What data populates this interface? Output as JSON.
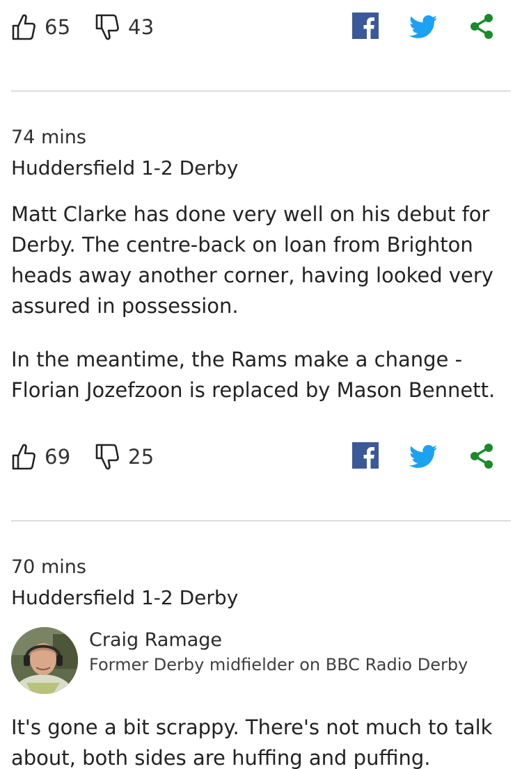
{
  "posts": [
    {
      "reactions": {
        "likes": "65",
        "dislikes": "43"
      }
    },
    {
      "time": "74 mins",
      "title": "Huddersfield 1-2 Derby",
      "paragraphs": [
        "Matt Clarke has done very well on his debut for Derby. The centre-back on loan from Brighton heads away another corner, having looked very assured in possession.",
        "In the meantime, the Rams make a change - Florian Jozefzoon is replaced by Mason Bennett."
      ],
      "reactions": {
        "likes": "69",
        "dislikes": "25"
      }
    },
    {
      "time": "70 mins",
      "title": "Huddersfield 1-2 Derby",
      "contributor": {
        "name": "Craig Ramage",
        "role": "Former Derby midfielder on BBC Radio Derby"
      },
      "paragraphs": [
        "It's gone a bit scrappy. There's not much to talk about, both sides are huffing and puffing."
      ]
    }
  ],
  "icons": {
    "like": "thumbs-up-icon",
    "dislike": "thumbs-down-icon",
    "facebook": "facebook-icon",
    "twitter": "twitter-icon",
    "share": "share-icon"
  },
  "colors": {
    "facebook": "#3b5998",
    "twitter": "#1da1f2",
    "share": "#1a8a2a",
    "divider": "#dcdcdc",
    "text": "#222222"
  }
}
